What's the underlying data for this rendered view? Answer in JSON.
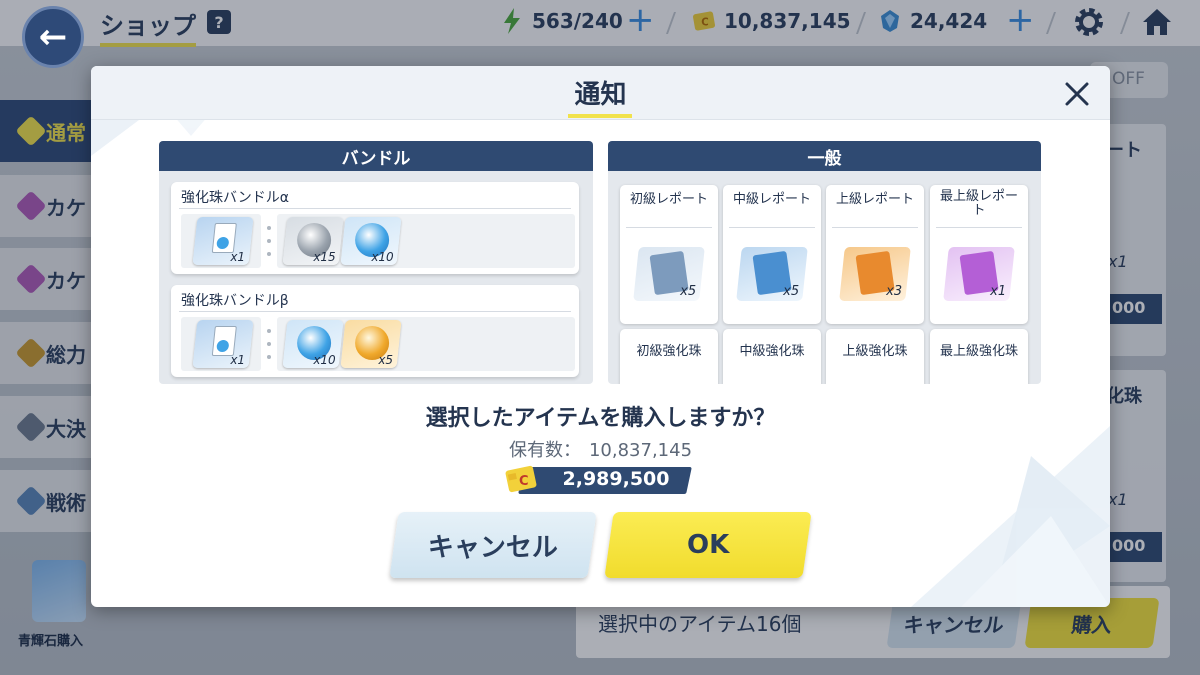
{
  "topbar": {
    "title": "ショップ",
    "help_label": "?",
    "ap": "563/240",
    "credits": "10,837,145",
    "pyroxene": "24,424"
  },
  "sidebar": {
    "items": [
      {
        "label": "通常"
      },
      {
        "label": "カケ"
      },
      {
        "label": "カケ"
      },
      {
        "label": "総力"
      },
      {
        "label": "大決"
      },
      {
        "label": "戦術"
      }
    ]
  },
  "right_column": {
    "toggle": "OFF",
    "card1_title": "ート",
    "card1_qty": "x1",
    "card1_price": "000",
    "card2_title": "化珠",
    "card2_qty": "x1",
    "card2_price": "000"
  },
  "bottom_bar": {
    "selected_text": "選択中のアイテム16個",
    "cancel_label": "キャンセル",
    "buy_label": "購入"
  },
  "gem_shop": {
    "label": "青輝石購入"
  },
  "modal": {
    "title": "通知",
    "bundle_panel": {
      "header": "バンドル",
      "bundles": [
        {
          "name": "強化珠バンドルα",
          "main_qty": "x1",
          "items": [
            {
              "qty": "x15",
              "color": "#9aa3ad"
            },
            {
              "qty": "x10",
              "color": "#3fa3e6"
            }
          ]
        },
        {
          "name": "強化珠バンドルβ",
          "main_qty": "x1",
          "items": [
            {
              "qty": "x10",
              "color": "#3fa3e6"
            },
            {
              "qty": "x5",
              "color": "#f0a92c"
            }
          ]
        }
      ]
    },
    "general_panel": {
      "header": "一般",
      "reports": [
        {
          "title": "初級レポート",
          "qty": "x5",
          "color": "#c9d9e8",
          "doc": "#7d9bbd"
        },
        {
          "title": "中級レポート",
          "qty": "x5",
          "color": "#bcd7f0",
          "doc": "#4a8fd0"
        },
        {
          "title": "上級レポート",
          "qty": "x3",
          "color": "#f6c88a",
          "doc": "#e88a2e"
        },
        {
          "title": "最上級レポート",
          "qty": "x1",
          "color": "#e3c2f2",
          "doc": "#b45fd6"
        }
      ],
      "orbs": [
        {
          "title": "初級強化珠"
        },
        {
          "title": "中級強化珠"
        },
        {
          "title": "上級強化珠"
        },
        {
          "title": "最上級強化珠"
        }
      ]
    },
    "confirm_text": "選択したアイテムを購入しますか？",
    "owned_label": "保有数：",
    "owned_value": "10,837,145",
    "cost": "2,989,500",
    "cancel_label": "キャンセル",
    "ok_label": "OK"
  }
}
